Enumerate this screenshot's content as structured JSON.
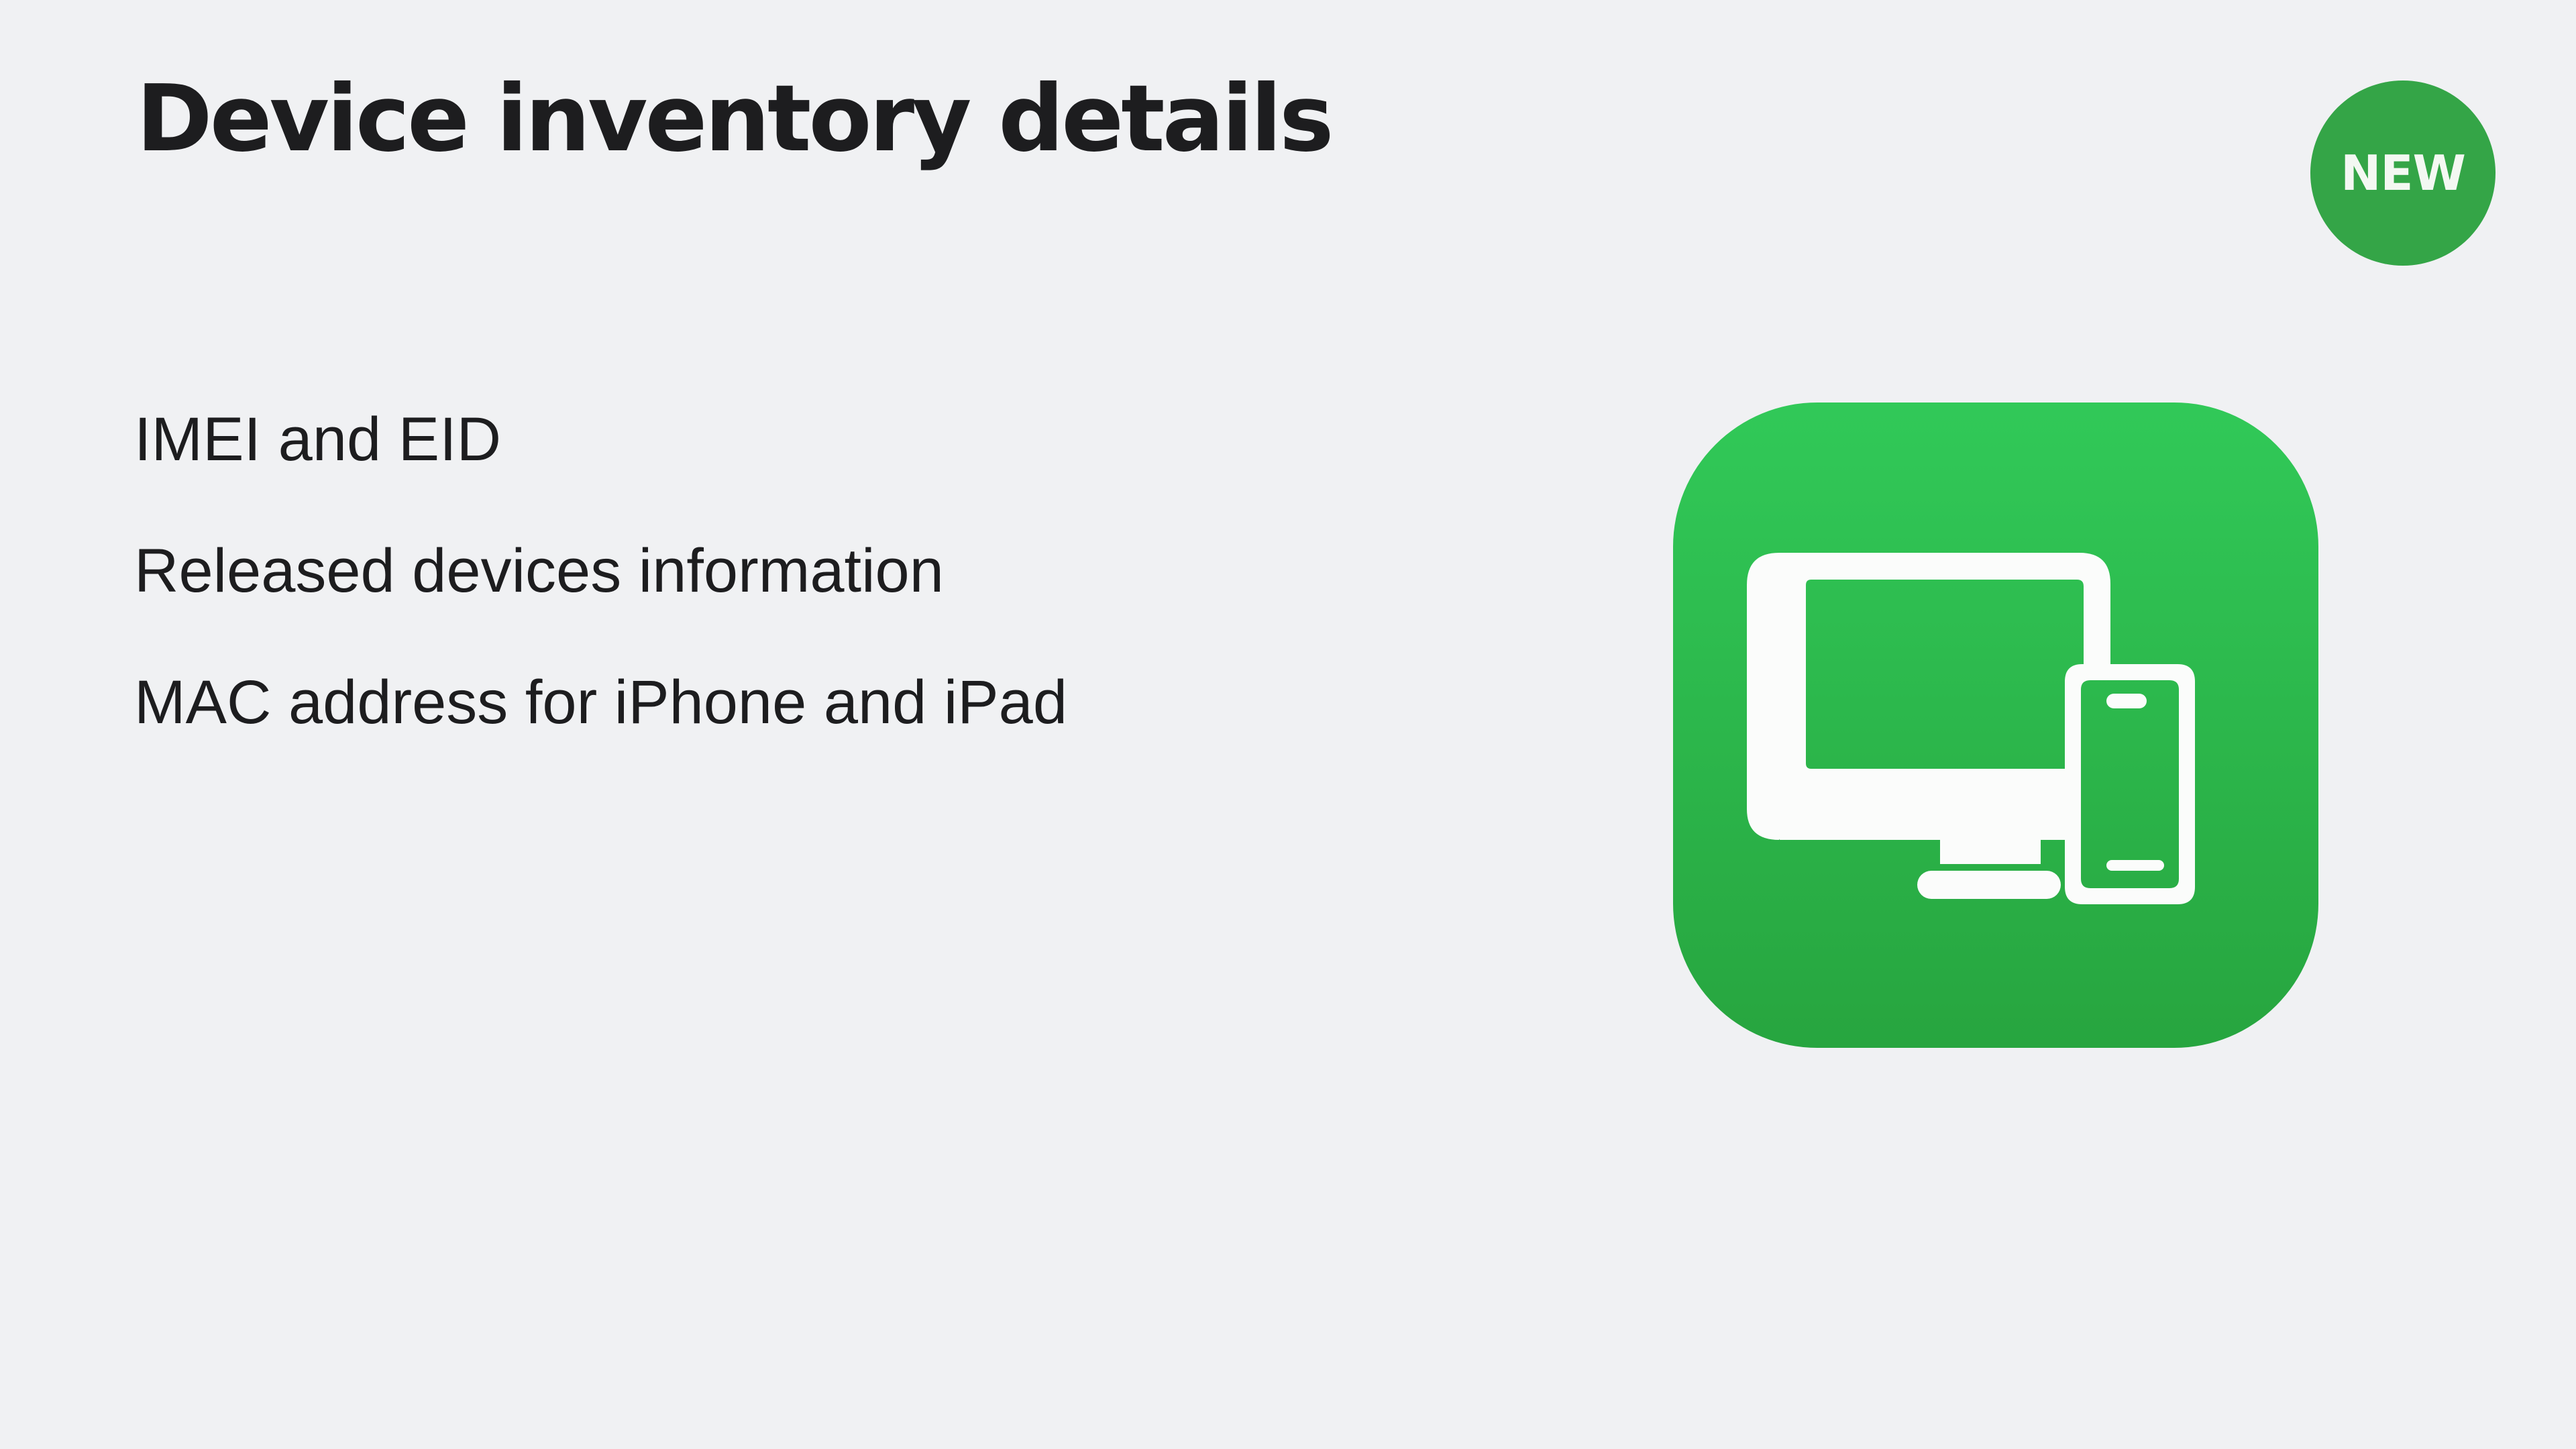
{
  "slide": {
    "title": "Device inventory details",
    "badge": "NEW",
    "bullets": [
      "IMEI and EID",
      "Released devices information",
      "MAC address for iPhone and iPad"
    ],
    "icon": "devices-app-icon"
  },
  "colors": {
    "background": "#f0f1f3",
    "text": "#1d1d1f",
    "badge": "#34a547",
    "icon_gradient_top": "#31c958",
    "icon_gradient_bottom": "#27a53f",
    "glyph": "#fbfcfb"
  }
}
